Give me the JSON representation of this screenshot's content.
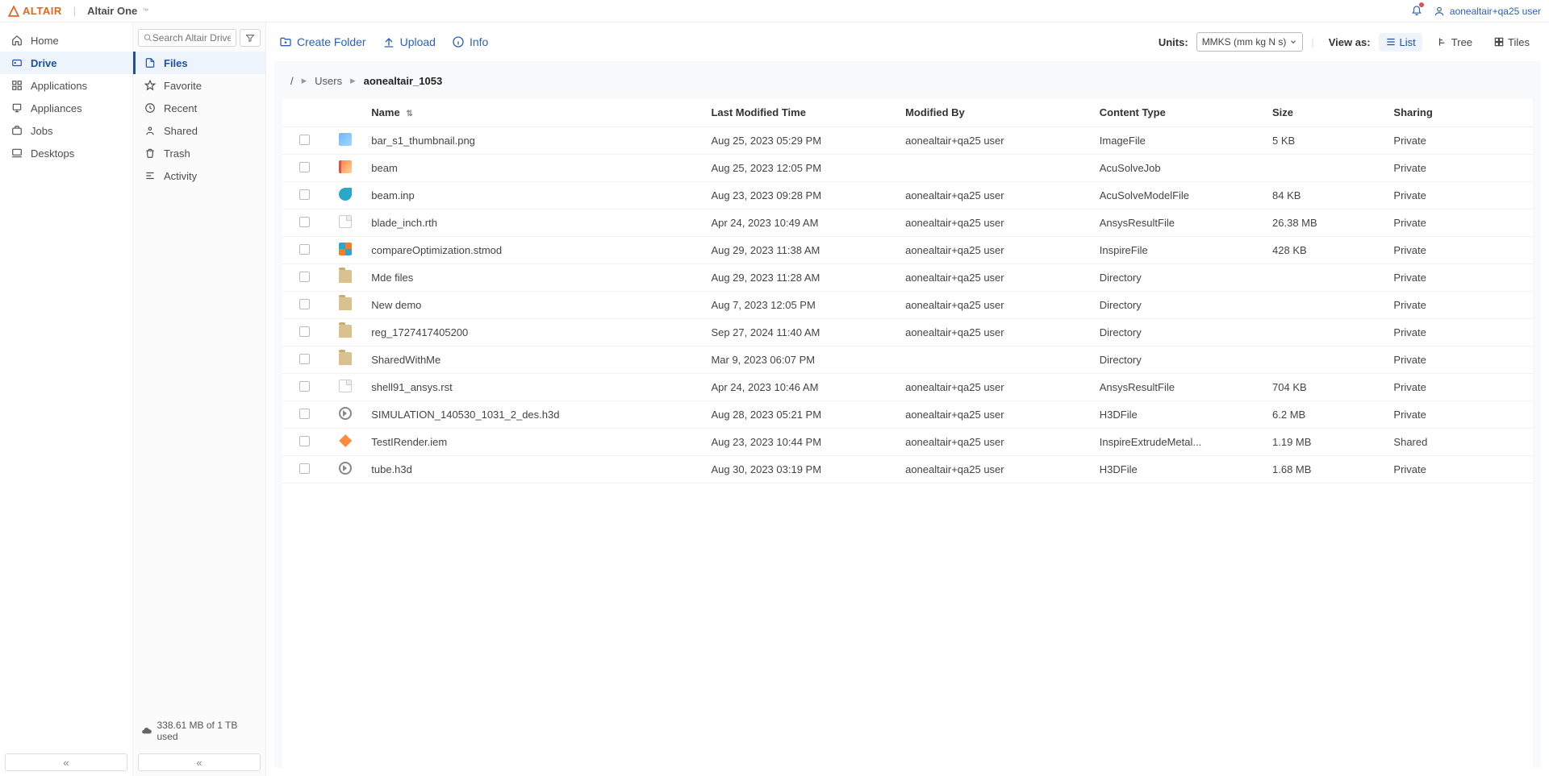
{
  "brand": {
    "name": "ALTAIR",
    "sub": "Altair One"
  },
  "user": {
    "display": "aonealtair+qa25 user"
  },
  "sidebar1": {
    "items": [
      {
        "label": "Home"
      },
      {
        "label": "Drive"
      },
      {
        "label": "Applications"
      },
      {
        "label": "Appliances"
      },
      {
        "label": "Jobs"
      },
      {
        "label": "Desktops"
      }
    ]
  },
  "sidebar2": {
    "search_placeholder": "Search Altair Drive",
    "items": [
      {
        "label": "Files"
      },
      {
        "label": "Favorite"
      },
      {
        "label": "Recent"
      },
      {
        "label": "Shared"
      },
      {
        "label": "Trash"
      },
      {
        "label": "Activity"
      }
    ],
    "storage": "338.61 MB of 1 TB used"
  },
  "toolbar": {
    "create": "Create Folder",
    "upload": "Upload",
    "info": "Info",
    "units_label": "Units:",
    "units_value": "MMKS (mm kg N s)",
    "view_label": "View as:",
    "view_list": "List",
    "view_tree": "Tree",
    "view_tiles": "Tiles"
  },
  "breadcrumb": {
    "root": "/",
    "users": "Users",
    "current": "aonealtair_1053"
  },
  "table": {
    "headers": {
      "name": "Name",
      "modified": "Last Modified Time",
      "by": "Modified By",
      "type": "Content Type",
      "size": "Size",
      "sharing": "Sharing"
    },
    "rows": [
      {
        "icon": "img",
        "name": "bar_s1_thumbnail.png",
        "modified": "Aug 25, 2023 05:29 PM",
        "by": "aonealtair+qa25 user",
        "type": "ImageFile",
        "size": "5 KB",
        "sharing": "Private"
      },
      {
        "icon": "acusolve",
        "name": "beam",
        "modified": "Aug 25, 2023 12:05 PM",
        "by": "",
        "type": "AcuSolveJob",
        "size": "",
        "sharing": "Private"
      },
      {
        "icon": "acumodel",
        "name": "beam.inp",
        "modified": "Aug 23, 2023 09:28 PM",
        "by": "aonealtair+qa25 user",
        "type": "AcuSolveModelFile",
        "size": "84 KB",
        "sharing": "Private"
      },
      {
        "icon": "generic",
        "name": "blade_inch.rth",
        "modified": "Apr 24, 2023 10:49 AM",
        "by": "aonealtair+qa25 user",
        "type": "AnsysResultFile",
        "size": "26.38 MB",
        "sharing": "Private"
      },
      {
        "icon": "inspire",
        "name": "compareOptimization.stmod",
        "modified": "Aug 29, 2023 11:38 AM",
        "by": "aonealtair+qa25 user",
        "type": "InspireFile",
        "size": "428 KB",
        "sharing": "Private"
      },
      {
        "icon": "dir",
        "name": "Mde files",
        "modified": "Aug 29, 2023 11:28 AM",
        "by": "aonealtair+qa25 user",
        "type": "Directory",
        "size": "",
        "sharing": "Private"
      },
      {
        "icon": "dir",
        "name": "New demo",
        "modified": "Aug 7, 2023 12:05 PM",
        "by": "aonealtair+qa25 user",
        "type": "Directory",
        "size": "",
        "sharing": "Private"
      },
      {
        "icon": "dir",
        "name": "reg_1727417405200",
        "modified": "Sep 27, 2024 11:40 AM",
        "by": "aonealtair+qa25 user",
        "type": "Directory",
        "size": "",
        "sharing": "Private"
      },
      {
        "icon": "dir",
        "name": "SharedWithMe",
        "modified": "Mar 9, 2023 06:07 PM",
        "by": "",
        "type": "Directory",
        "size": "",
        "sharing": "Private"
      },
      {
        "icon": "generic",
        "name": "shell91_ansys.rst",
        "modified": "Apr 24, 2023 10:46 AM",
        "by": "aonealtair+qa25 user",
        "type": "AnsysResultFile",
        "size": "704 KB",
        "sharing": "Private"
      },
      {
        "icon": "h3d",
        "name": "SIMULATION_140530_1031_2_des.h3d",
        "modified": "Aug 28, 2023 05:21 PM",
        "by": "aonealtair+qa25 user",
        "type": "H3DFile",
        "size": "6.2 MB",
        "sharing": "Private"
      },
      {
        "icon": "extrude",
        "name": "TestIRender.iem",
        "modified": "Aug 23, 2023 10:44 PM",
        "by": "aonealtair+qa25 user",
        "type": "InspireExtrudeMetal...",
        "size": "1.19 MB",
        "sharing": "Shared"
      },
      {
        "icon": "h3d",
        "name": "tube.h3d",
        "modified": "Aug 30, 2023 03:19 PM",
        "by": "aonealtair+qa25 user",
        "type": "H3DFile",
        "size": "1.68 MB",
        "sharing": "Private"
      }
    ]
  }
}
